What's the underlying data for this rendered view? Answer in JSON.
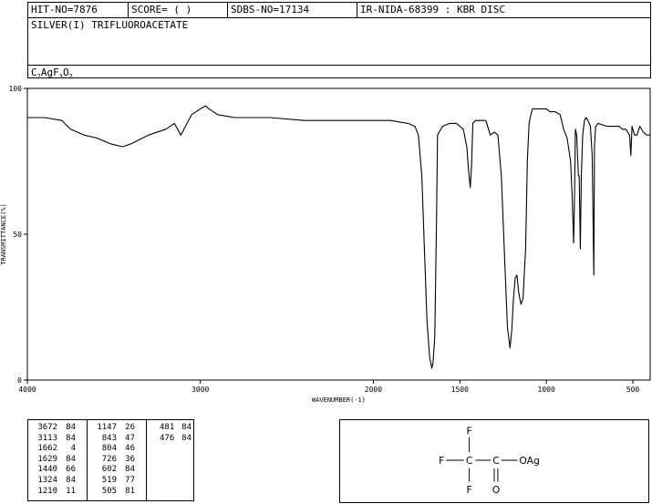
{
  "header": {
    "hit_no": "HIT-NO=7876",
    "score": "SCORE=  (   )",
    "sdbs_no": "SDBS-NO=17134",
    "ir_id": "IR-NIDA-68399 : KBR DISC"
  },
  "compound": {
    "name": "SILVER(I) TRIFLUOROACETATE",
    "formula_parts": [
      "C",
      "2",
      "AgF",
      "3",
      "O",
      "2"
    ]
  },
  "chart_data": {
    "type": "line",
    "xlabel": "WAVENUMBER(-1)",
    "ylabel": "TRANSMITTANCE(%)",
    "xlim": [
      4000,
      400
    ],
    "ylim": [
      0,
      100
    ],
    "x_ticks": [
      4000,
      3000,
      2000,
      1500,
      1000,
      500
    ],
    "y_ticks": [
      0,
      50,
      100
    ],
    "grid": false,
    "series": [
      {
        "x": [
          4000,
          3900,
          3800,
          3750,
          3672,
          3600,
          3520,
          3450,
          3400,
          3300,
          3200,
          3150,
          3113,
          3050,
          3000,
          2970,
          2950,
          2900,
          2800,
          2600,
          2400,
          2200,
          2000,
          1900,
          1800,
          1760,
          1740,
          1720,
          1705,
          1690,
          1675,
          1662,
          1655,
          1645,
          1635,
          1629,
          1620,
          1600,
          1560,
          1520,
          1480,
          1460,
          1450,
          1440,
          1432,
          1425,
          1410,
          1380,
          1350,
          1324,
          1300,
          1280,
          1260,
          1240,
          1225,
          1210,
          1200,
          1190,
          1180,
          1170,
          1160,
          1147,
          1135,
          1120,
          1110,
          1100,
          1090,
          1080,
          1060,
          1040,
          1020,
          1000,
          980,
          950,
          920,
          900,
          880,
          860,
          850,
          843,
          838,
          832,
          825,
          815,
          810,
          804,
          798,
          790,
          780,
          770,
          760,
          745,
          735,
          726,
          722,
          715,
          700,
          650,
          600,
          580,
          560,
          540,
          530,
          519,
          512,
          505,
          500,
          490,
          481,
          476,
          460,
          440,
          420,
          400
        ],
        "y": [
          90,
          90,
          89,
          86,
          84,
          83,
          81,
          80,
          81,
          84,
          86,
          88,
          84,
          91,
          93,
          94,
          93,
          91,
          90,
          90,
          89,
          89,
          89,
          89,
          88,
          87,
          84,
          70,
          45,
          20,
          8,
          4,
          6,
          15,
          55,
          84,
          85,
          87,
          88,
          88,
          86,
          80,
          72,
          66,
          74,
          88,
          89,
          89,
          89,
          84,
          85,
          84,
          70,
          40,
          18,
          11,
          17,
          28,
          35,
          36,
          30,
          26,
          28,
          45,
          75,
          88,
          91,
          93,
          93,
          93,
          93,
          93,
          92,
          92,
          91,
          86,
          83,
          75,
          62,
          47,
          60,
          86,
          84,
          70,
          70,
          45,
          70,
          84,
          89,
          90,
          89,
          87,
          77,
          36,
          80,
          87,
          88,
          87,
          87,
          87,
          86,
          86,
          85,
          84,
          77,
          87,
          86,
          84,
          84,
          84,
          87,
          85,
          84,
          84
        ]
      }
    ]
  },
  "peak_table": [
    [
      [
        "3672",
        "84"
      ],
      [
        "3113",
        "84"
      ],
      [
        "1662",
        "4"
      ],
      [
        "1629",
        "84"
      ],
      [
        "1440",
        "66"
      ],
      [
        "1324",
        "84"
      ],
      [
        "1210",
        "11"
      ]
    ],
    [
      [
        "1147",
        "26"
      ],
      [
        "843",
        "47"
      ],
      [
        "804",
        "46"
      ],
      [
        "726",
        "36"
      ],
      [
        "602",
        "84"
      ],
      [
        "519",
        "77"
      ],
      [
        "505",
        "81"
      ]
    ],
    [
      [
        "481",
        "84"
      ],
      [
        "476",
        "84"
      ]
    ]
  ],
  "structure": {
    "atom_f_top": "F",
    "atom_f_left": "F",
    "atom_f_bottom": "F",
    "atom_c1": "C",
    "atom_c2": "C",
    "atom_o_double": "O",
    "group_oag": "OAg"
  }
}
